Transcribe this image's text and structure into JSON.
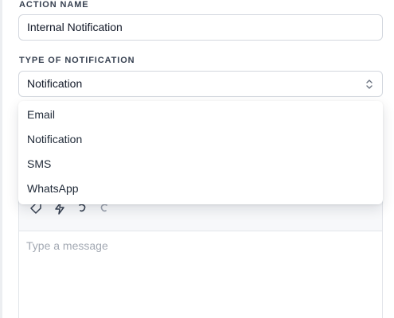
{
  "form": {
    "action_name_label": "ACTION NAME",
    "action_name_value": "Internal Notification",
    "type_label": "TYPE OF NOTIFICATION",
    "type_selected": "Notification"
  },
  "dropdown": {
    "options": [
      "Email",
      "Notification",
      "SMS",
      "WhatsApp"
    ]
  },
  "editor": {
    "placeholder": "Type a message",
    "toolbar_icons": [
      "tag-icon",
      "lightning-icon",
      "undo-icon",
      "redo-icon"
    ]
  }
}
